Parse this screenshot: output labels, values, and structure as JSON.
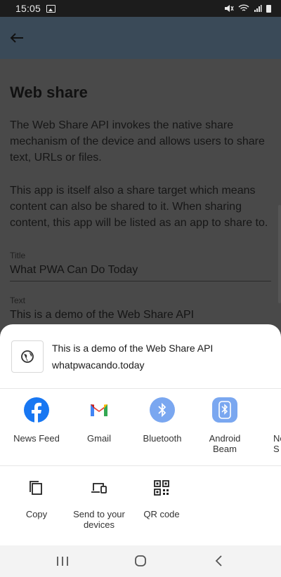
{
  "status_bar": {
    "time": "15:05",
    "icons": [
      "gallery-icon",
      "mute-icon",
      "wifi-icon",
      "signal-icon",
      "battery-icon"
    ]
  },
  "app_bar": {
    "back_icon": "back-arrow-icon"
  },
  "page": {
    "title": "Web share",
    "paragraph1": "The Web Share API invokes the native share mechanism of the device and allows users to share text, URLs or files.",
    "paragraph2": "This app is itself also a share target which means content can also be shared to it. When sharing content, this app will be listed as an app to share to.",
    "title_field": {
      "label": "Title",
      "value": "What PWA Can Do Today"
    },
    "text_field": {
      "label": "Text",
      "value": "This is a demo of the Web Share API"
    }
  },
  "share_sheet": {
    "preview": {
      "text": "This is a demo of the Web Share API",
      "url": "whatpwacando.today",
      "icon": "globe-icon"
    },
    "apps": [
      {
        "label": "News Feed",
        "icon": "facebook-icon",
        "color": "#1877f2"
      },
      {
        "label": "Gmail",
        "icon": "gmail-icon",
        "color": "#ea4335"
      },
      {
        "label": "Bluetooth",
        "icon": "bluetooth-icon",
        "color": "#7aa7f0"
      },
      {
        "label": "Android Beam",
        "label_line1": "Android",
        "label_line2": "Beam",
        "icon": "bluetooth-icon",
        "color": "#7aa7f0"
      },
      {
        "label_line1": "Ne",
        "label_line2": "S",
        "icon": "bluetooth-icon",
        "color": "#1a6fd8"
      }
    ],
    "actions": [
      {
        "label": "Copy",
        "icon": "copy-icon"
      },
      {
        "label_line1": "Send to your",
        "label_line2": "devices",
        "icon": "devices-icon"
      },
      {
        "label": "QR code",
        "icon": "qr-code-icon"
      }
    ]
  },
  "nav_bar": {
    "icons": [
      "recents-icon",
      "home-icon",
      "back-icon"
    ]
  }
}
